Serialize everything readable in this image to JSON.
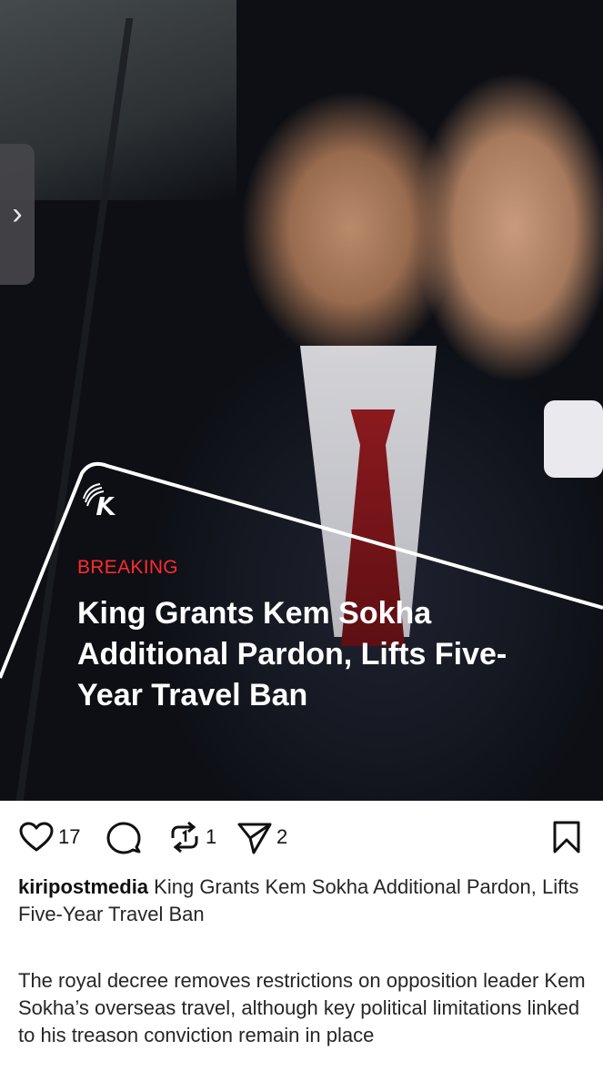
{
  "post": {
    "image": {
      "tag": "BREAKING",
      "headline": "King Grants Kem Sokha Additional Pardon, Lifts Five-Year Travel Ban",
      "logo": "kiripost-k-logo"
    },
    "side_tab_icon": "chevron-right-icon",
    "actions": {
      "like_icon": "heart-icon",
      "like_count": "17",
      "comment_icon": "comment-icon",
      "repost_icon": "repost-icon",
      "repost_count": "1",
      "share_icon": "send-icon",
      "share_count": "2",
      "save_icon": "bookmark-icon"
    },
    "caption": {
      "username": "kiripostmedia",
      "text": "King Grants Kem Sokha Additional Pardon, Lifts Five-Year Travel Ban"
    },
    "description": "The royal decree removes restrictions on opposition leader Kem Sokha’s overseas travel, although key political limitations linked to his treason conviction remain in place"
  }
}
